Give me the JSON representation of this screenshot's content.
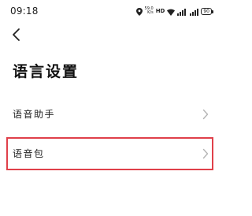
{
  "status_bar": {
    "time": "09:18",
    "net_speed_value": "59.0",
    "net_speed_unit": "K/s",
    "hd_label": "HD",
    "battery_level": "90",
    "icons": [
      "location-icon",
      "wifi-icon",
      "signal-icon",
      "battery-icon"
    ]
  },
  "header": {
    "back_icon": "chevron-left-icon",
    "title": "语言设置"
  },
  "settings": {
    "items": [
      {
        "label": "语音助手",
        "icon": "chevron-right-icon"
      },
      {
        "label": "语音包",
        "icon": "chevron-right-icon",
        "highlighted": true
      }
    ]
  },
  "colors": {
    "highlight": "#e0404a",
    "chevron": "#b5b5b5",
    "text": "#111111"
  }
}
